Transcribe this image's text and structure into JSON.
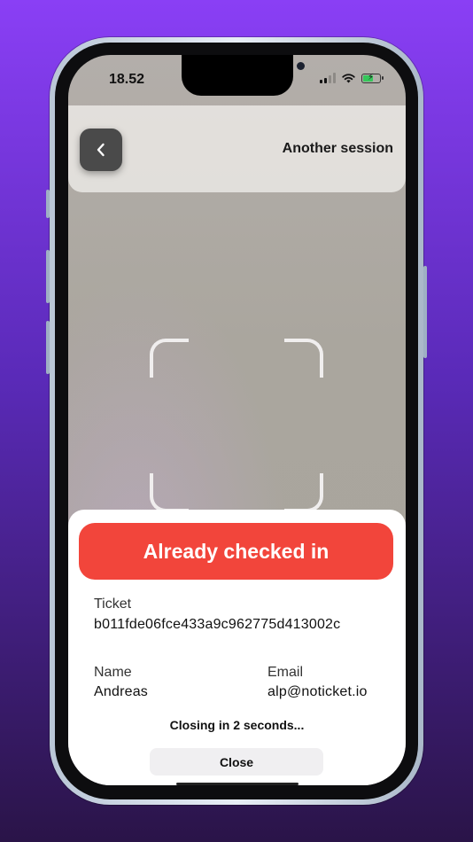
{
  "status_bar": {
    "time": "18.52",
    "icons": [
      "cellular-signal-icon",
      "wifi-icon",
      "battery-charging-icon"
    ]
  },
  "header": {
    "back_icon": "chevron-left-icon",
    "session_title": "Another session"
  },
  "scanner": {
    "frame_icon": "qr-scan-frame-icon"
  },
  "result": {
    "banner_text": "Already checked in",
    "banner_color": "#f2453b",
    "ticket_label": "Ticket",
    "ticket_value": "b011fde06fce433a9c962775d413002c",
    "name_label": "Name",
    "name_value": "Andreas",
    "email_label": "Email",
    "email_value": "alp@noticket.io",
    "closing_text": "Closing in 2 seconds...",
    "close_label": "Close"
  },
  "colors": {
    "background_top": "#8a3ff5",
    "background_bottom": "#2a1448",
    "back_button": "#4a4a4a",
    "battery_fill": "#35c75a"
  }
}
